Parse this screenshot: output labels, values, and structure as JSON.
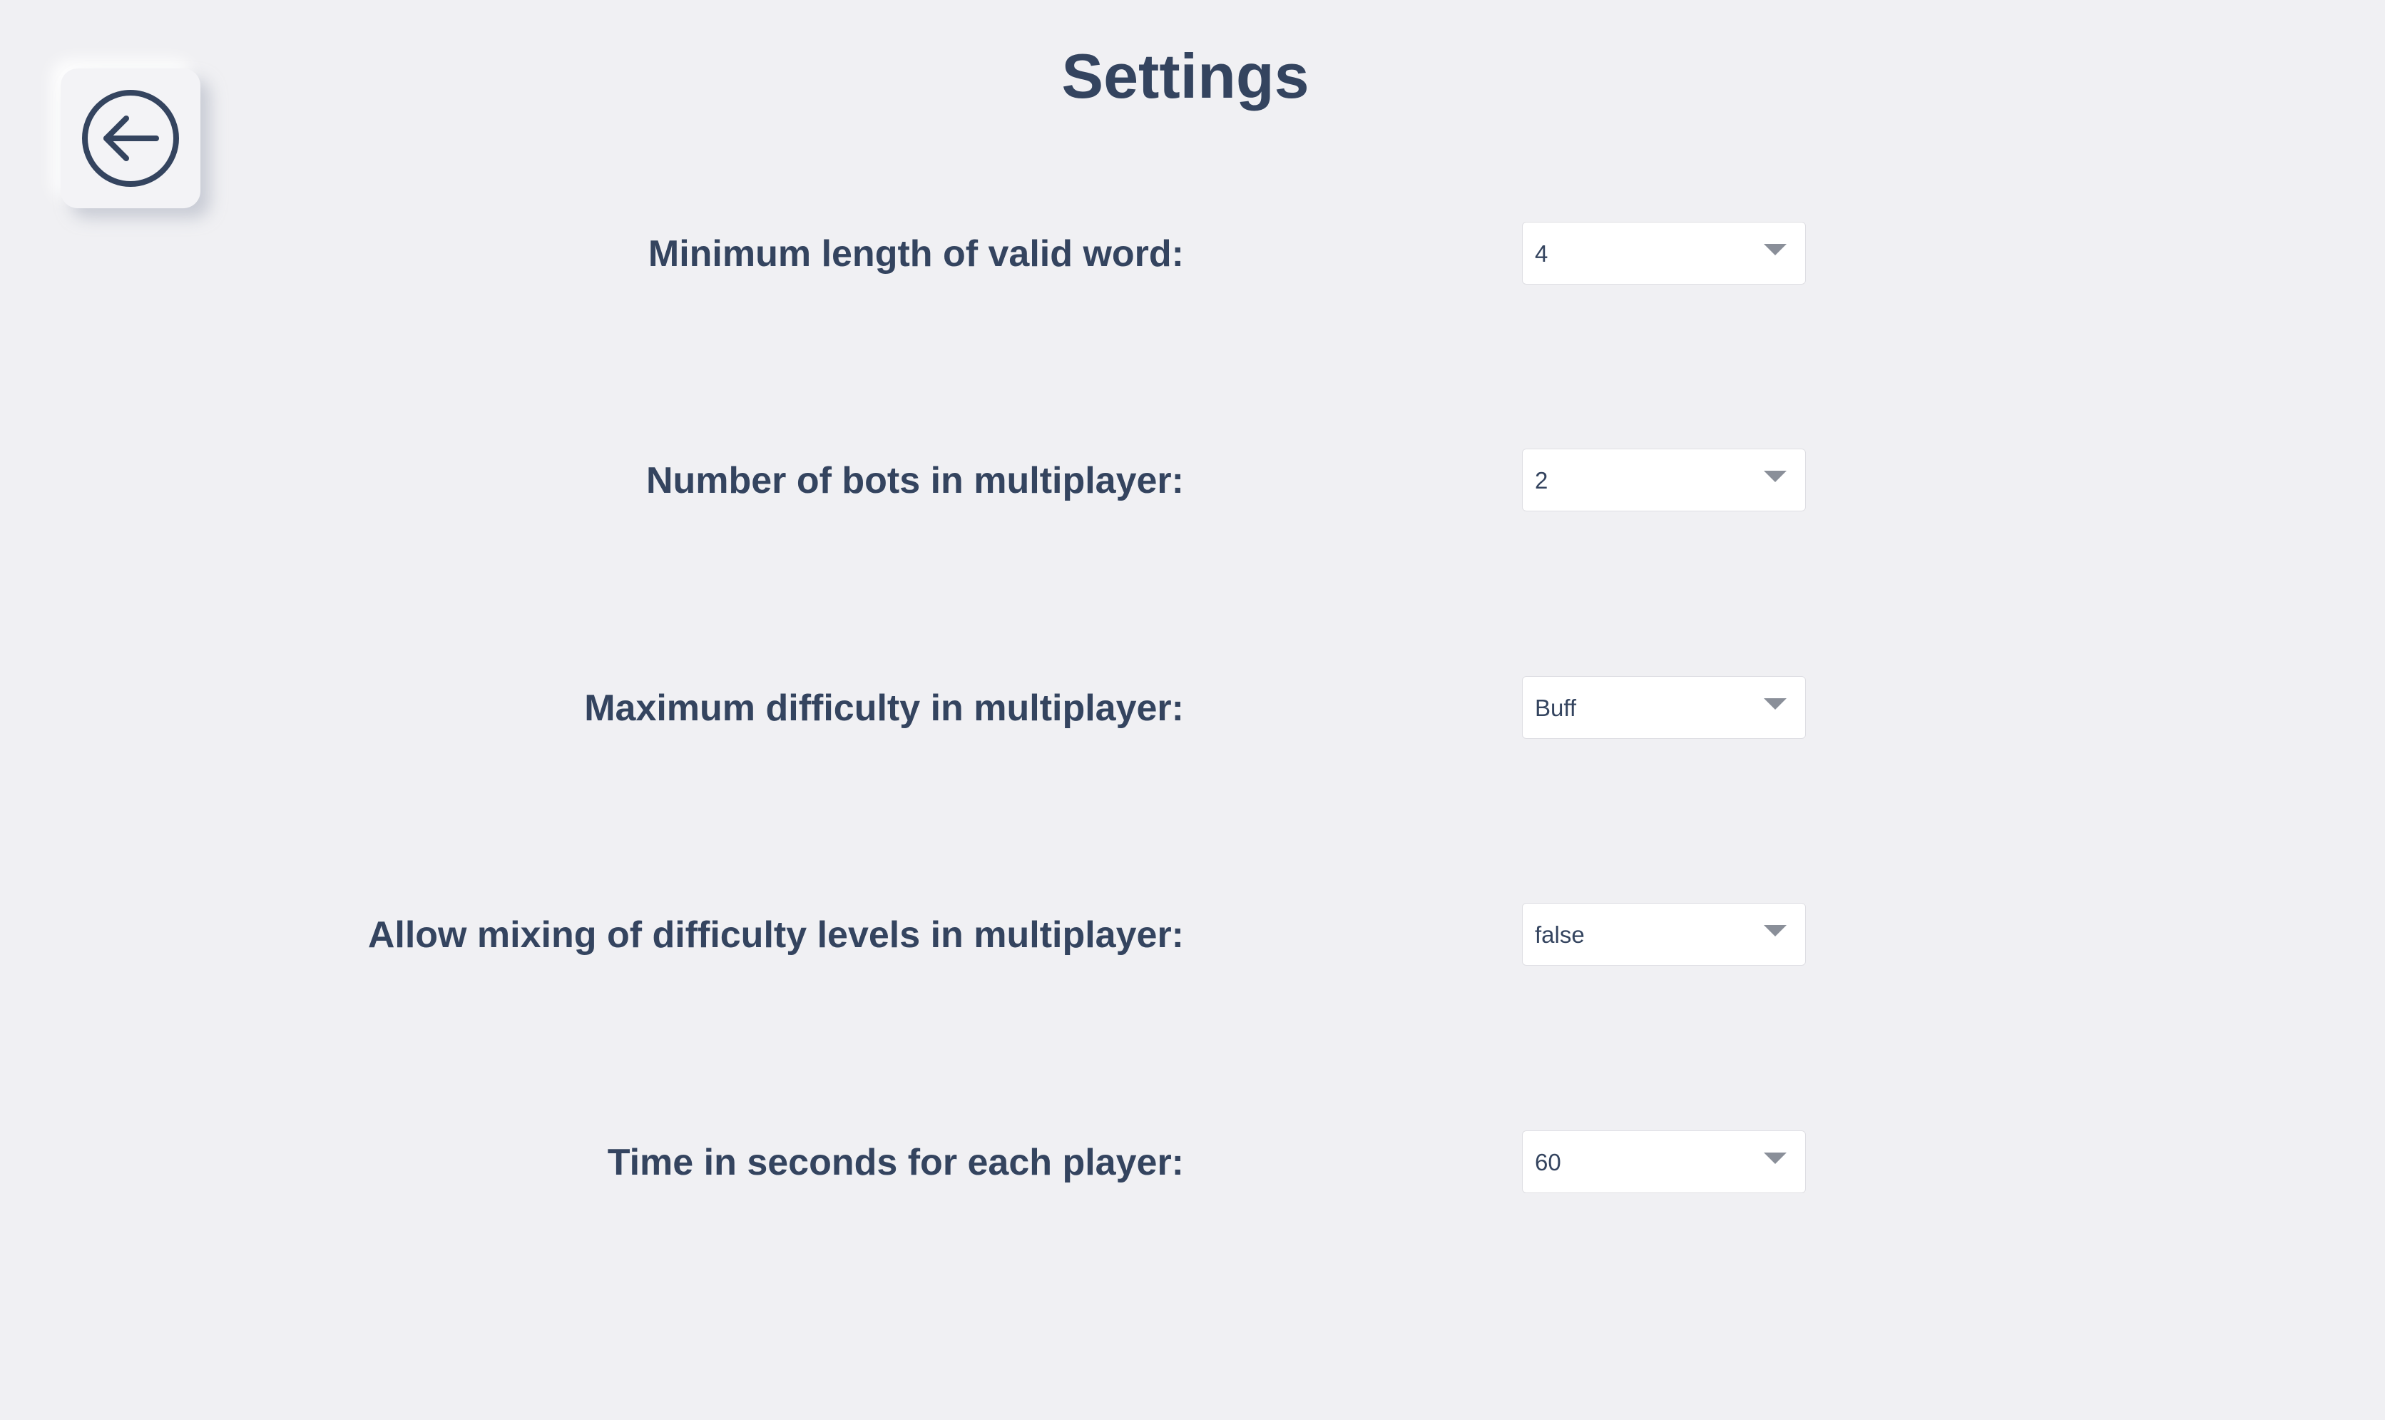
{
  "page": {
    "title": "Settings"
  },
  "back_button": {
    "icon": "arrow-left-circle-icon"
  },
  "settings": [
    {
      "label": "Minimum length of valid word:",
      "value": "4"
    },
    {
      "label": "Number of bots in multiplayer:",
      "value": "2"
    },
    {
      "label": "Maximum difficulty in multiplayer:",
      "value": "Buff"
    },
    {
      "label": "Allow mixing of difficulty levels in multiplayer:",
      "value": "false"
    },
    {
      "label": "Time in seconds for each player:",
      "value": "60"
    }
  ],
  "colors": {
    "background": "#f0f0f3",
    "text": "#34445f",
    "select_background": "#ffffff",
    "dropdown_arrow": "#8a8f99"
  }
}
